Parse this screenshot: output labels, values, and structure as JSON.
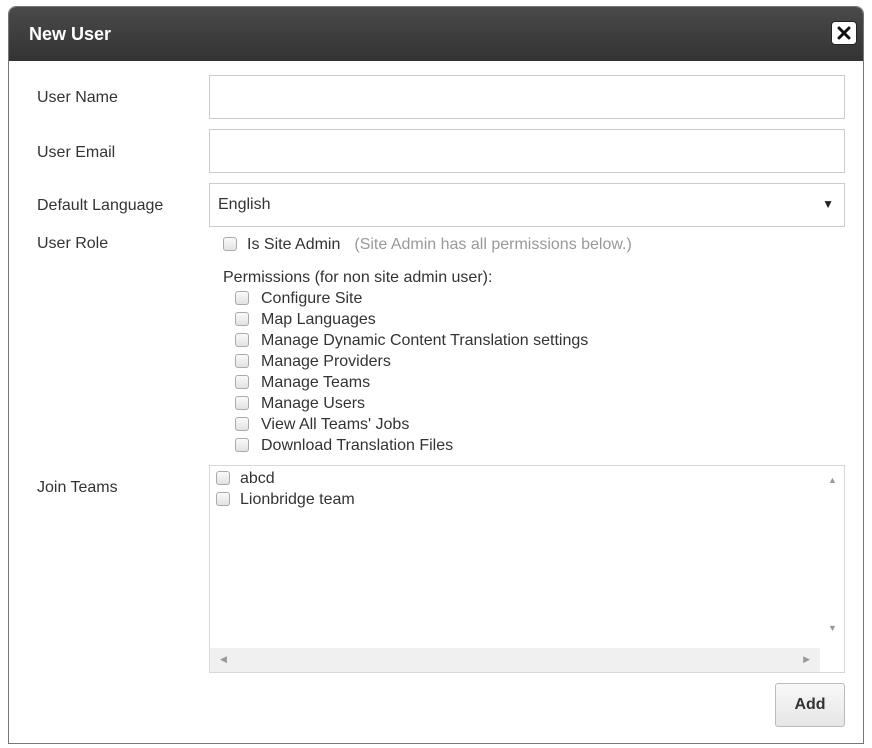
{
  "dialog": {
    "title": "New User",
    "close_icon": "close-icon"
  },
  "form": {
    "user_name": {
      "label": "User Name",
      "value": ""
    },
    "user_email": {
      "label": "User Email",
      "value": ""
    },
    "default_language": {
      "label": "Default Language",
      "selected": "English"
    },
    "user_role": {
      "label": "User Role",
      "site_admin_label": "Is Site Admin",
      "site_admin_note": "(Site Admin has all permissions below.)",
      "site_admin_checked": false
    },
    "permissions": {
      "heading": "Permissions (for non site admin user):",
      "items": [
        {
          "label": "Configure Site",
          "checked": false
        },
        {
          "label": "Map Languages",
          "checked": false
        },
        {
          "label": "Manage Dynamic Content Translation settings",
          "checked": false
        },
        {
          "label": "Manage Providers",
          "checked": false
        },
        {
          "label": "Manage Teams",
          "checked": false
        },
        {
          "label": "Manage Users",
          "checked": false
        },
        {
          "label": "View All Teams' Jobs",
          "checked": false
        },
        {
          "label": "Download Translation Files",
          "checked": false
        }
      ]
    },
    "join_teams": {
      "label": "Join Teams",
      "teams": [
        {
          "label": "abcd",
          "checked": false
        },
        {
          "label": "Lionbridge team",
          "checked": false
        }
      ]
    }
  },
  "actions": {
    "add_label": "Add"
  },
  "colors": {
    "titlebar": "#3a3a3a",
    "title_text": "#ffffff",
    "note_text": "#999999",
    "border": "#cccccc"
  }
}
